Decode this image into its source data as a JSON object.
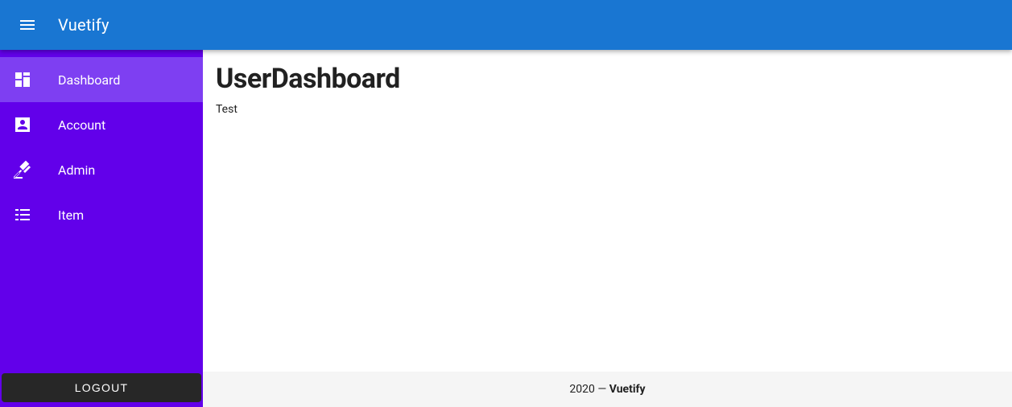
{
  "header": {
    "title": "Vuetify"
  },
  "sidebar": {
    "items": [
      {
        "label": "Dashboard",
        "icon": "dashboard",
        "active": true
      },
      {
        "label": "Account",
        "icon": "account",
        "active": false
      },
      {
        "label": "Admin",
        "icon": "gavel",
        "active": false
      },
      {
        "label": "Item",
        "icon": "list",
        "active": false
      }
    ],
    "logout_label": "LOGOUT"
  },
  "main": {
    "title": "UserDashboard",
    "body": "Test"
  },
  "footer": {
    "year": "2020",
    "separator": " — ",
    "brand": "Vuetify"
  }
}
